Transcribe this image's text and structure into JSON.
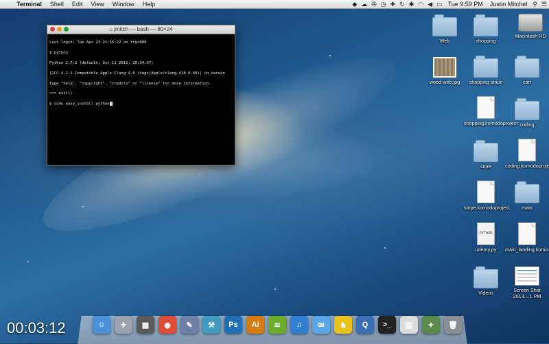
{
  "menubar": {
    "app_name": "Terminal",
    "items": [
      "Shell",
      "Edit",
      "View",
      "Window",
      "Help"
    ],
    "clock": "Tue 9:59 PM",
    "user": "Justin Mitchel"
  },
  "terminal": {
    "title": "jmitch — bash — 80×24",
    "lines": [
      "Last login: Tue Apr 23 21:55:22 on ttys000",
      "$ python",
      "Python 2.7.2 (default, Oct 11 2012, 20:14:37)",
      "[GCC 4.2.1 Compatible Apple Clang 4.0 (tags/Apple/clang-418.0.60)] on darwin",
      "Type \"help\", \"copyright\", \"credits\" or \"license\" for more information.",
      ">>> exit()",
      "$ sudo easy_install python"
    ]
  },
  "desktop_icons": [
    {
      "label": "Macintosh HD",
      "kind": "hd"
    },
    {
      "label": "Web",
      "kind": "folder"
    },
    {
      "label": "shopping",
      "kind": "folder"
    },
    {
      "label": "wood-web.jpg",
      "kind": "image"
    },
    {
      "label": "shopping stripe",
      "kind": "folder"
    },
    {
      "label": "cart",
      "kind": "folder"
    },
    {
      "label": "shopping.komodoproject",
      "kind": "doc"
    },
    {
      "label": "coding",
      "kind": "folder"
    },
    {
      "label": "store",
      "kind": "folder"
    },
    {
      "label": "coding.komodoproject",
      "kind": "doc"
    },
    {
      "label": "stripe.komodoproject",
      "kind": "doc"
    },
    {
      "label": "main",
      "kind": "folder"
    },
    {
      "label": "udemy.py",
      "kind": "python",
      "badge": "PYTHON"
    },
    {
      "label": "main_landing.komo...roject",
      "kind": "doc"
    },
    {
      "label": "Videos",
      "kind": "folder"
    },
    {
      "label": "Screen Shot 2013....1 PM",
      "kind": "screenshot"
    }
  ],
  "timer": "00:03:12",
  "dock": {
    "items": [
      {
        "name": "finder",
        "glyph": "☺",
        "color": "#4a90d9"
      },
      {
        "name": "launchpad",
        "glyph": "✈",
        "color": "#9aa3ad"
      },
      {
        "name": "photo-booth",
        "glyph": "▦",
        "color": "#5a5a5a"
      },
      {
        "name": "chrome",
        "glyph": "◉",
        "color": "#dd4b39"
      },
      {
        "name": "preview",
        "glyph": "✎",
        "color": "#6e7fa8"
      },
      {
        "name": "xcode",
        "glyph": "⚒",
        "color": "#3f9bbf"
      },
      {
        "name": "photoshop",
        "glyph": "Ps",
        "color": "#1f6fb6"
      },
      {
        "name": "illustrator",
        "glyph": "Ai",
        "color": "#d67a12"
      },
      {
        "name": "spotify",
        "glyph": "≋",
        "color": "#6aab2a"
      },
      {
        "name": "itunes",
        "glyph": "♫",
        "color": "#2f7fd4"
      },
      {
        "name": "messages",
        "glyph": "✉",
        "color": "#59a6e8"
      },
      {
        "name": "cyberduck",
        "glyph": "♞",
        "color": "#e7c21b"
      },
      {
        "name": "quicktime",
        "glyph": "Q",
        "color": "#3b6fb3"
      },
      {
        "name": "terminal",
        "glyph": ">_",
        "color": "#222222"
      },
      {
        "name": "documents",
        "glyph": "▤",
        "color": "#dcdcdc"
      },
      {
        "name": "applications",
        "glyph": "✦",
        "color": "#5a8a4a"
      },
      {
        "name": "trash",
        "glyph": "🗑",
        "color": "#8a8f96"
      }
    ]
  }
}
